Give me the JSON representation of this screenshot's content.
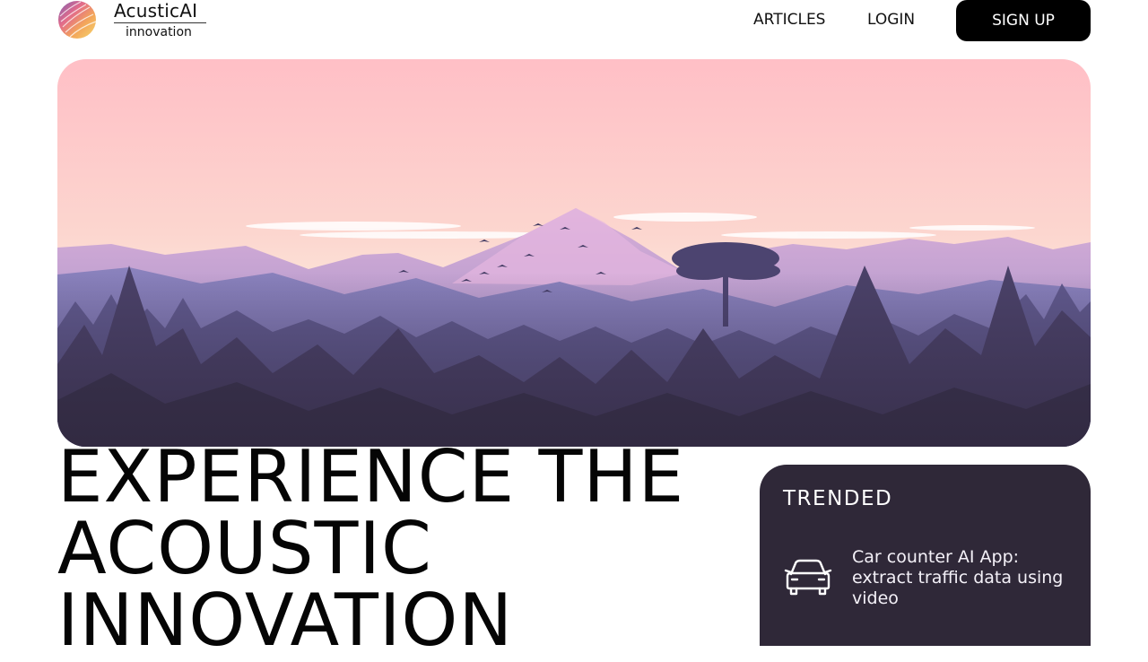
{
  "header": {
    "logo_name": "AcusticAI",
    "logo_tagline": "innovation",
    "nav": {
      "articles": "ARTICLES",
      "login": "LOGIN",
      "signup": "SIGN UP"
    }
  },
  "hero": {
    "headline": "EXPERIENCE THE ACOUSTIC INNOVATION"
  },
  "trended": {
    "title": "TRENDED",
    "items": [
      {
        "icon": "car-icon",
        "text": "Car counter AI App: extract traffic data using video"
      }
    ]
  },
  "colors": {
    "button_bg": "#000000",
    "card_bg": "#2f2838",
    "sky_top": "#ffc0c8",
    "sky_bottom": "#fbe4d6",
    "mountain": "#8e85bf",
    "forest_dark": "#3b3450"
  }
}
